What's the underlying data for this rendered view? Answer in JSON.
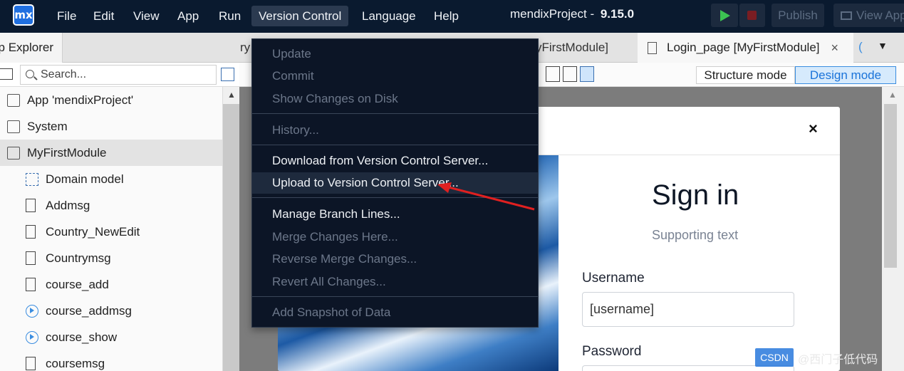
{
  "topbar": {
    "logo_text": "mx",
    "menus": [
      "File",
      "Edit",
      "View",
      "App",
      "Run",
      "Version Control",
      "Language",
      "Help"
    ],
    "project_name": "mendixProject",
    "version": "9.15.0",
    "publish_label": "Publish",
    "view_app_label": "View App"
  },
  "tabs": {
    "panel_label": "p Explorer",
    "hidden_tab_prefix": "ry",
    "partial_tab": "yFirstModule]",
    "active_tab": "Login_page [MyFirstModule]",
    "close_glyph": "×"
  },
  "explorer": {
    "search_placeholder": "Search...",
    "items": [
      {
        "label": "App 'mendixProject'",
        "icon": "app-cube-icon"
      },
      {
        "label": "System",
        "icon": "module-icon"
      },
      {
        "label": "MyFirstModule",
        "icon": "module-icon"
      },
      {
        "label": "Domain model",
        "icon": "domain-model-icon"
      },
      {
        "label": "Addmsg",
        "icon": "page-icon"
      },
      {
        "label": "Country_NewEdit",
        "icon": "page-icon"
      },
      {
        "label": "Countrymsg",
        "icon": "page-icon"
      },
      {
        "label": "course_add",
        "icon": "page-icon"
      },
      {
        "label": "course_addmsg",
        "icon": "microflow-icon"
      },
      {
        "label": "course_show",
        "icon": "microflow-icon"
      },
      {
        "label": "coursemsg",
        "icon": "page-icon"
      }
    ]
  },
  "editor": {
    "structure_mode": "Structure mode",
    "design_mode": "Design mode"
  },
  "login_modal": {
    "close_glyph": "×",
    "title": "Sign in",
    "subtitle": "Supporting text",
    "username_label": "Username",
    "username_value": "[username]",
    "password_label": "Password"
  },
  "version_control_menu": {
    "items": [
      {
        "label": "Update",
        "enabled": false
      },
      {
        "label": "Commit",
        "enabled": false
      },
      {
        "label": "Show Changes on Disk",
        "enabled": false
      },
      {
        "label": "History...",
        "enabled": false
      },
      {
        "label": "Download from Version Control Server...",
        "enabled": true
      },
      {
        "label": "Upload to Version Control Server...",
        "enabled": true
      },
      {
        "label": "Manage Branch Lines...",
        "enabled": true
      },
      {
        "label": "Merge Changes Here...",
        "enabled": false
      },
      {
        "label": "Reverse Merge Changes...",
        "enabled": false
      },
      {
        "label": "Revert All Changes...",
        "enabled": false
      },
      {
        "label": "Add Snapshot of Data",
        "enabled": false
      }
    ]
  },
  "watermark": {
    "badge": "CSDN",
    "text": "@西门子低代码"
  },
  "colors": {
    "topbar_bg": "#0a1a2f",
    "menu_bg": "#0c1526",
    "accent": "#3a8de0",
    "annotation_arrow": "#e02020"
  }
}
